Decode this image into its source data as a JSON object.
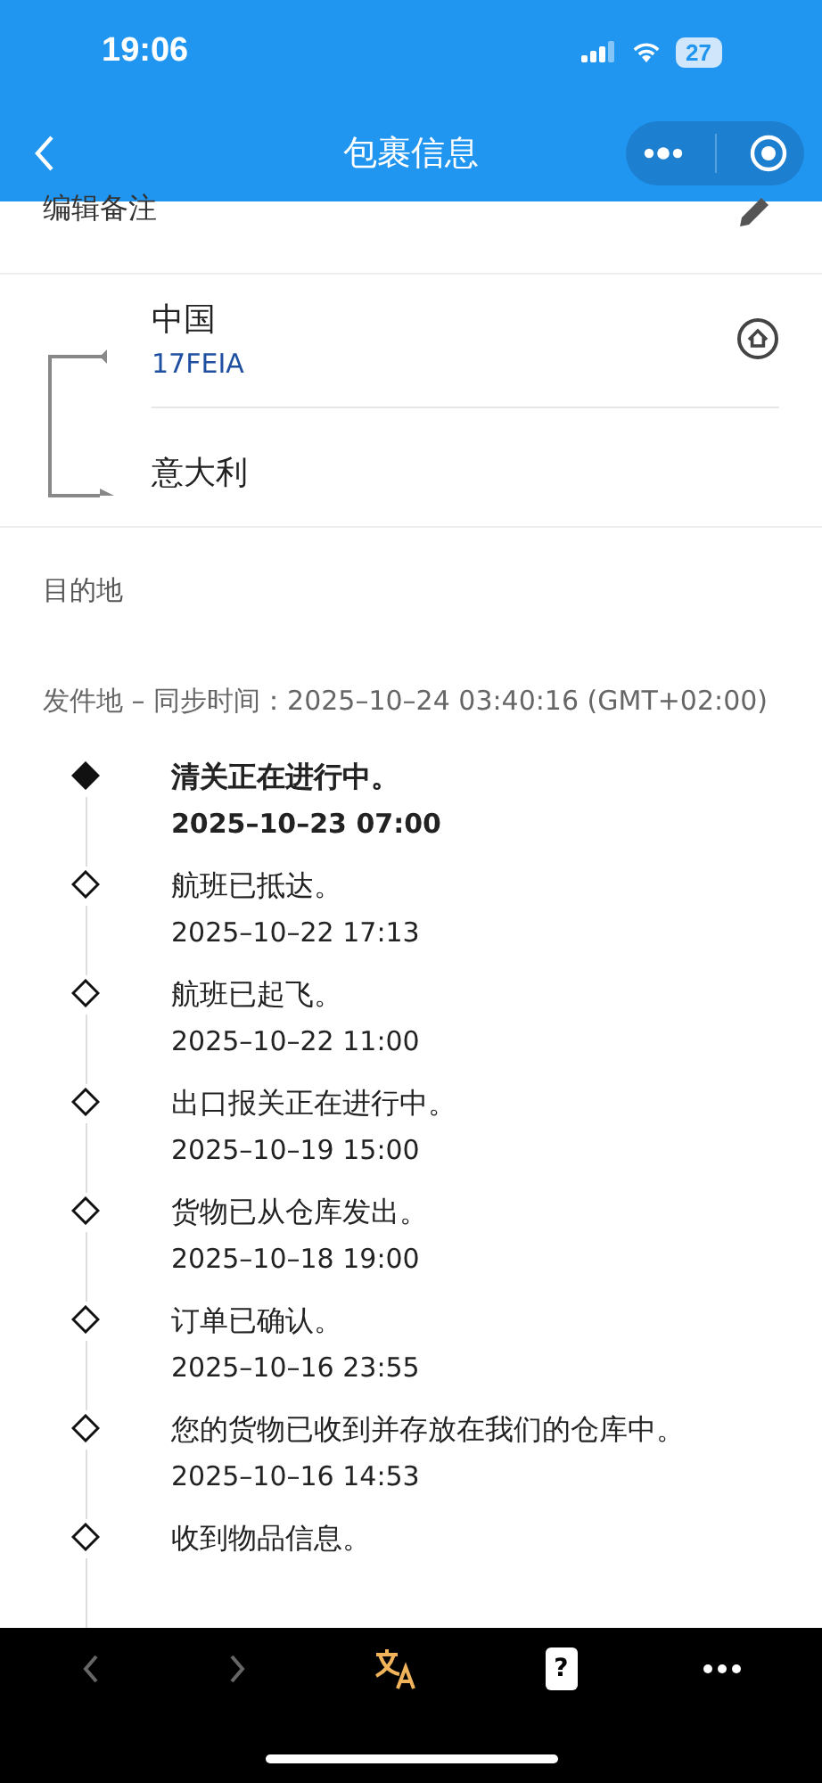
{
  "status_bar": {
    "time": "19:06",
    "battery": "27"
  },
  "nav": {
    "title": "包裹信息"
  },
  "note": {
    "label": "编辑备注"
  },
  "route": {
    "origin": "中国",
    "carrier": "17FEIA",
    "destination": "意大利"
  },
  "destination_label": "目的地",
  "sync": "发件地 – 同步时间：2025–10–24 03:40:16 (GMT+02:00)",
  "events": [
    {
      "text": "清关正在进行中。",
      "time": "2025–10–23 07:00",
      "current": true
    },
    {
      "text": "航班已抵达。",
      "time": "2025–10–22 17:13",
      "current": false
    },
    {
      "text": "航班已起飞。",
      "time": "2025–10–22 11:00",
      "current": false
    },
    {
      "text": "出口报关正在进行中。",
      "time": "2025–10–19 15:00",
      "current": false
    },
    {
      "text": "货物已从仓库发出。",
      "time": "2025–10–18 19:00",
      "current": false
    },
    {
      "text": "订单已确认。",
      "time": "2025–10–16 23:55",
      "current": false
    },
    {
      "text": "您的货物已收到并存放在我们的仓库中。",
      "time": "2025–10–16 14:53",
      "current": false
    },
    {
      "text": "收到物品信息。",
      "current": false
    }
  ],
  "toolbar": {
    "help_glyph": "?"
  }
}
